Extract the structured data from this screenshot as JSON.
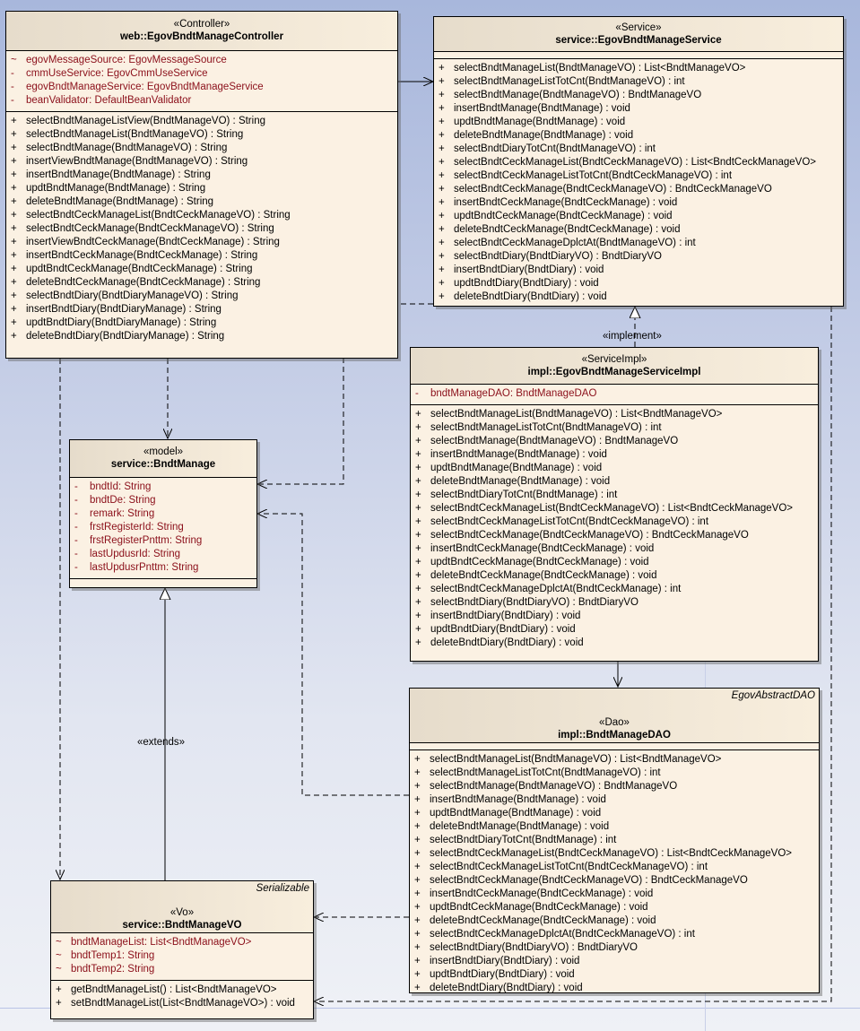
{
  "classes": [
    {
      "id": "controller",
      "stereotype": "«Controller»",
      "name": "web::EgovBndtManageController",
      "tag": "",
      "attributes": [
        [
          "~",
          "egovMessageSource:  EgovMessageSource"
        ],
        [
          "-",
          "cmmUseService:  EgovCmmUseService"
        ],
        [
          "-",
          "egovBndtManageService:  EgovBndtManageService"
        ],
        [
          "-",
          "beanValidator:  DefaultBeanValidator"
        ]
      ],
      "operations": [
        [
          "+",
          "selectBndtManageListView(BndtManageVO) : String"
        ],
        [
          "+",
          "selectBndtManageList(BndtManageVO) : String"
        ],
        [
          "+",
          "selectBndtManage(BndtManageVO) : String"
        ],
        [
          "+",
          "insertViewBndtManage(BndtManageVO) : String"
        ],
        [
          "+",
          "insertBndtManage(BndtManage) : String"
        ],
        [
          "+",
          "updtBndtManage(BndtManage) : String"
        ],
        [
          "+",
          "deleteBndtManage(BndtManage) : String"
        ],
        [
          "+",
          "selectBndtCeckManageList(BndtCeckManageVO) : String"
        ],
        [
          "+",
          "selectBndtCeckManage(BndtCeckManageVO) : String"
        ],
        [
          "+",
          "insertViewBndtCeckManage(BndtCeckManage) : String"
        ],
        [
          "+",
          "insertBndtCeckManage(BndtCeckManage) : String"
        ],
        [
          "+",
          "updtBndtCeckManage(BndtCeckManage) : String"
        ],
        [
          "+",
          "deleteBndtCeckManage(BndtCeckManage) : String"
        ],
        [
          "+",
          "selectBndtDiary(BndtDiaryManageVO) : String"
        ],
        [
          "+",
          "insertBndtDiary(BndtDiaryManage) : String"
        ],
        [
          "+",
          "updtBndtDiary(BndtDiaryManage) : String"
        ],
        [
          "+",
          "deleteBndtDiary(BndtDiaryManage) : String"
        ]
      ]
    },
    {
      "id": "service",
      "stereotype": "«Service»",
      "name": "service::EgovBndtManageService",
      "tag": "",
      "attributes": [],
      "operations": [
        [
          "+",
          "selectBndtManageList(BndtManageVO) : List<BndtManageVO>"
        ],
        [
          "+",
          "selectBndtManageListTotCnt(BndtManageVO) : int"
        ],
        [
          "+",
          "selectBndtManage(BndtManageVO) : BndtManageVO"
        ],
        [
          "+",
          "insertBndtManage(BndtManage) : void"
        ],
        [
          "+",
          "updtBndtManage(BndtManage) : void"
        ],
        [
          "+",
          "deleteBndtManage(BndtManage) : void"
        ],
        [
          "+",
          "selectBndtDiaryTotCnt(BndtManageVO) : int"
        ],
        [
          "+",
          "selectBndtCeckManageList(BndtCeckManageVO) : List<BndtCeckManageVO>"
        ],
        [
          "+",
          "selectBndtCeckManageListTotCnt(BndtCeckManageVO) : int"
        ],
        [
          "+",
          "selectBndtCeckManage(BndtCeckManageVO) : BndtCeckManageVO"
        ],
        [
          "+",
          "insertBndtCeckManage(BndtCeckManage) : void"
        ],
        [
          "+",
          "updtBndtCeckManage(BndtCeckManage) : void"
        ],
        [
          "+",
          "deleteBndtCeckManage(BndtCeckManage) : void"
        ],
        [
          "+",
          "selectBndtCeckManageDplctAt(BndtManageVO) : int"
        ],
        [
          "+",
          "selectBndtDiary(BndtDiaryVO) : BndtDiaryVO"
        ],
        [
          "+",
          "insertBndtDiary(BndtDiary) : void"
        ],
        [
          "+",
          "updtBndtDiary(BndtDiary) : void"
        ],
        [
          "+",
          "deleteBndtDiary(BndtDiary) : void"
        ]
      ]
    },
    {
      "id": "impl",
      "stereotype": "«ServiceImpl»",
      "name": "impl::EgovBndtManageServiceImpl",
      "tag": "",
      "attributes": [
        [
          "-",
          "bndtManageDAO:  BndtManageDAO"
        ]
      ],
      "operations": [
        [
          "+",
          "selectBndtManageList(BndtManageVO) : List<BndtManageVO>"
        ],
        [
          "+",
          "selectBndtManageListTotCnt(BndtManageVO) : int"
        ],
        [
          "+",
          "selectBndtManage(BndtManageVO) : BndtManageVO"
        ],
        [
          "+",
          "insertBndtManage(BndtManage) : void"
        ],
        [
          "+",
          "updtBndtManage(BndtManage) : void"
        ],
        [
          "+",
          "deleteBndtManage(BndtManage) : void"
        ],
        [
          "+",
          "selectBndtDiaryTotCnt(BndtManage) : int"
        ],
        [
          "+",
          "selectBndtCeckManageList(BndtCeckManageVO) : List<BndtCeckManageVO>"
        ],
        [
          "+",
          "selectBndtCeckManageListTotCnt(BndtCeckManageVO) : int"
        ],
        [
          "+",
          "selectBndtCeckManage(BndtCeckManageVO) : BndtCeckManageVO"
        ],
        [
          "+",
          "insertBndtCeckManage(BndtCeckManage) : void"
        ],
        [
          "+",
          "updtBndtCeckManage(BndtCeckManage) : void"
        ],
        [
          "+",
          "deleteBndtCeckManage(BndtCeckManage) : void"
        ],
        [
          "+",
          "selectBndtCeckManageDplctAt(BndtCeckManage) : int"
        ],
        [
          "+",
          "selectBndtDiary(BndtDiaryVO) : BndtDiaryVO"
        ],
        [
          "+",
          "insertBndtDiary(BndtDiary) : void"
        ],
        [
          "+",
          "updtBndtDiary(BndtDiary) : void"
        ],
        [
          "+",
          "deleteBndtDiary(BndtDiary) : void"
        ]
      ]
    },
    {
      "id": "dao",
      "stereotype": "«Dao»",
      "name": "impl::BndtManageDAO",
      "tag": "EgovAbstractDAO",
      "attributes": [],
      "operations": [
        [
          "+",
          "selectBndtManageList(BndtManageVO) : List<BndtManageVO>"
        ],
        [
          "+",
          "selectBndtManageListTotCnt(BndtManageVO) : int"
        ],
        [
          "+",
          "selectBndtManage(BndtManageVO) : BndtManageVO"
        ],
        [
          "+",
          "insertBndtManage(BndtManage) : void"
        ],
        [
          "+",
          "updtBndtManage(BndtManage) : void"
        ],
        [
          "+",
          "deleteBndtManage(BndtManage) : void"
        ],
        [
          "+",
          "selectBndtDiaryTotCnt(BndtManage) : int"
        ],
        [
          "+",
          "selectBndtCeckManageList(BndtCeckManageVO) : List<BndtCeckManageVO>"
        ],
        [
          "+",
          "selectBndtCeckManageListTotCnt(BndtCeckManageVO) : int"
        ],
        [
          "+",
          "selectBndtCeckManage(BndtCeckManageVO) : BndtCeckManageVO"
        ],
        [
          "+",
          "insertBndtCeckManage(BndtCeckManage) : void"
        ],
        [
          "+",
          "updtBndtCeckManage(BndtCeckManage) : void"
        ],
        [
          "+",
          "deleteBndtCeckManage(BndtCeckManage) : void"
        ],
        [
          "+",
          "selectBndtCeckManageDplctAt(BndtCeckManageVO) : int"
        ],
        [
          "+",
          "selectBndtDiary(BndtDiaryVO) : BndtDiaryVO"
        ],
        [
          "+",
          "insertBndtDiary(BndtDiary) : void"
        ],
        [
          "+",
          "updtBndtDiary(BndtDiary) : void"
        ],
        [
          "+",
          "deleteBndtDiary(BndtDiary) : void"
        ]
      ]
    },
    {
      "id": "model",
      "stereotype": "«model»",
      "name": "service::BndtManage",
      "tag": "",
      "attributes": [
        [
          "-",
          "bndtId:  String"
        ],
        [
          "-",
          "bndtDe:  String"
        ],
        [
          "-",
          "remark:  String"
        ],
        [
          "-",
          "frstRegisterId:  String"
        ],
        [
          "-",
          "frstRegisterPnttm:  String"
        ],
        [
          "-",
          "lastUpdusrId:  String"
        ],
        [
          "-",
          "lastUpdusrPnttm:  String"
        ]
      ],
      "operations": []
    },
    {
      "id": "vo",
      "stereotype": "«Vo»",
      "name": "service::BndtManageVO",
      "tag": "Serializable",
      "attributes": [
        [
          "~",
          "bndtManageList:  List<BndtManageVO>"
        ],
        [
          "~",
          "bndtTemp1:  String"
        ],
        [
          "~",
          "bndtTemp2:  String"
        ]
      ],
      "operations": [
        [
          "+",
          "getBndtManageList() : List<BndtManageVO>"
        ],
        [
          "+",
          "setBndtManageList(List<BndtManageVO>) : void"
        ]
      ]
    }
  ],
  "relations": {
    "implement_label": "«implement»",
    "extends_label": "«extends»"
  },
  "colors": {
    "attribute_text": "#8b0f1a",
    "class_fill": "#fbf1e3",
    "background_top": "#a8b7dc"
  }
}
